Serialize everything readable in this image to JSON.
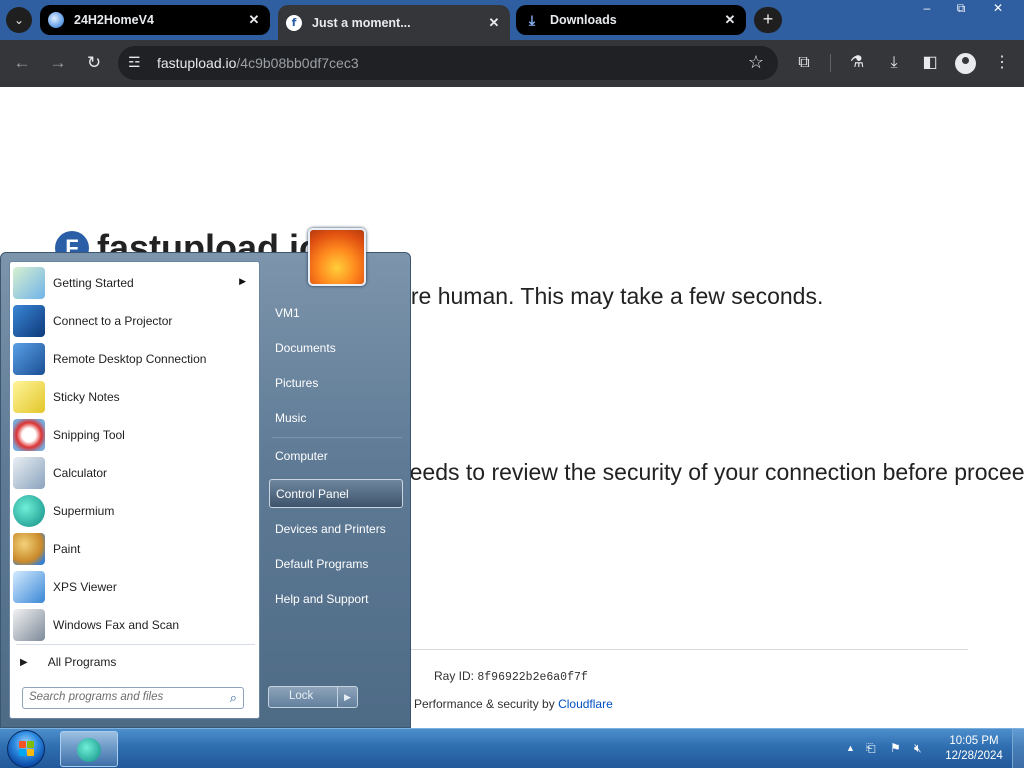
{
  "browser": {
    "tabs": [
      {
        "title": "24H2HomeV4",
        "favicon": "globe-icon",
        "active": false
      },
      {
        "title": "Just a moment...",
        "favicon": "fastupload-icon",
        "active": true
      },
      {
        "title": "Downloads",
        "favicon": "download-icon",
        "active": false
      }
    ],
    "url_host": "fastupload.io",
    "url_path": "/4c9b08bb0df7cec3"
  },
  "page": {
    "brand": "fastupload.io",
    "brand_logo_letter": "F",
    "heading": "Verifying you are human. This may take a few seconds.",
    "subtext": "fastupload.io needs to review the security of your connection before proceeding.",
    "ray_label": "Ray ID:",
    "ray_id": "8f96922b2e6a0f7f",
    "perf_prefix": "Performance & security by",
    "perf_link": "Cloudflare"
  },
  "start_menu": {
    "programs": [
      {
        "label": "Getting Started",
        "icon": "getting-started-icon",
        "has_submenu": true
      },
      {
        "label": "Connect to a Projector",
        "icon": "projector-icon",
        "has_submenu": false
      },
      {
        "label": "Remote Desktop Connection",
        "icon": "remote-desktop-icon",
        "has_submenu": false
      },
      {
        "label": "Sticky Notes",
        "icon": "sticky-notes-icon",
        "has_submenu": false
      },
      {
        "label": "Snipping Tool",
        "icon": "snipping-tool-icon",
        "has_submenu": false
      },
      {
        "label": "Calculator",
        "icon": "calculator-icon",
        "has_submenu": false
      },
      {
        "label": "Supermium",
        "icon": "supermium-icon",
        "has_submenu": false
      },
      {
        "label": "Paint",
        "icon": "paint-icon",
        "has_submenu": false
      },
      {
        "label": "XPS Viewer",
        "icon": "xps-viewer-icon",
        "has_submenu": false
      },
      {
        "label": "Windows Fax and Scan",
        "icon": "fax-scan-icon",
        "has_submenu": false
      }
    ],
    "all_programs": "All Programs",
    "search_placeholder": "Search programs and files",
    "right_items": [
      {
        "label": "VM1",
        "highlighted": false
      },
      {
        "label": "Documents",
        "highlighted": false
      },
      {
        "label": "Pictures",
        "highlighted": false
      },
      {
        "label": "Music",
        "highlighted": false
      },
      {
        "label": "Computer",
        "highlighted": false
      },
      {
        "label": "Control Panel",
        "highlighted": true
      },
      {
        "label": "Devices and Printers",
        "highlighted": false
      },
      {
        "label": "Default Programs",
        "highlighted": false
      },
      {
        "label": "Help and Support",
        "highlighted": false
      }
    ],
    "lock_label": "Lock"
  },
  "taskbar": {
    "pinned_app": "supermium-icon",
    "time": "10:05 PM",
    "date": "12/28/2024"
  },
  "colors": {
    "taskbar": "#2f6eb0",
    "browser_toolbar": "#35363a",
    "tabstrip": "#2f5fa0",
    "cloudflare_link": "#0051c3"
  }
}
